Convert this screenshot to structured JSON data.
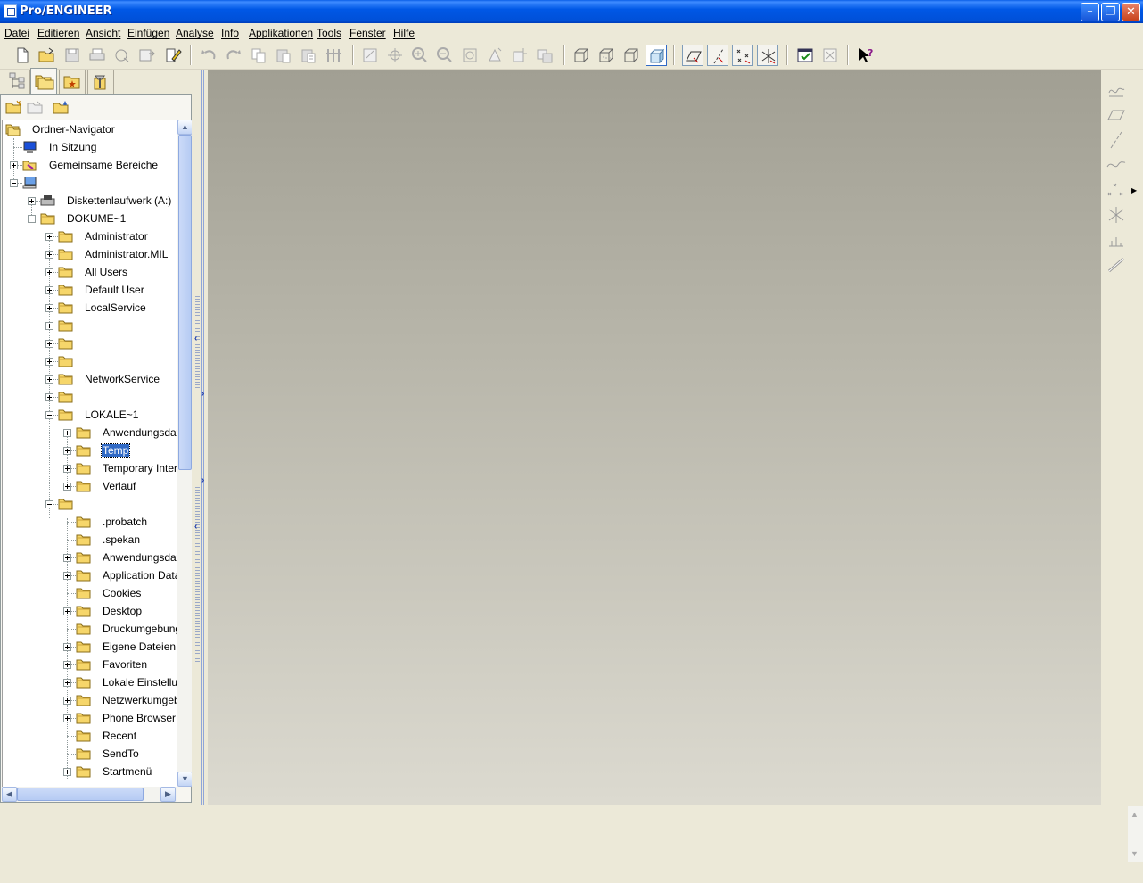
{
  "window": {
    "title": "Pro/ENGINEER",
    "minimize_glyph": "–",
    "maximize_glyph": "❐",
    "close_glyph": "✕"
  },
  "menu": [
    "Datei",
    "Editieren",
    "Ansicht",
    "Einfügen",
    "Analyse",
    "Info",
    "Applikationen",
    "Tools",
    "Fenster",
    "Hilfe"
  ],
  "navigator": {
    "tree": [
      {
        "label": "Ordner-Navigator",
        "icon": "folder-navigator-icon"
      },
      {
        "label": "In Sitzung",
        "icon": "monitor-icon"
      },
      {
        "label": "Gemeinsame Bereiche",
        "icon": "shared-areas-icon"
      },
      {
        "label": "",
        "icon": "computer-icon"
      },
      {
        "label": "Diskettenlaufwerk (A:)",
        "icon": "floppy-icon"
      },
      {
        "label": "DOKUME~1",
        "icon": "folder-icon"
      },
      {
        "label": "Administrator",
        "icon": "folder-icon"
      },
      {
        "label": "Administrator.MIL",
        "icon": "folder-icon"
      },
      {
        "label": "All Users",
        "icon": "folder-icon"
      },
      {
        "label": "Default User",
        "icon": "folder-icon"
      },
      {
        "label": "LocalService",
        "icon": "folder-icon"
      },
      {
        "label": "",
        "icon": "folder-icon"
      },
      {
        "label": "",
        "icon": "folder-icon"
      },
      {
        "label": "",
        "icon": "folder-icon"
      },
      {
        "label": "NetworkService",
        "icon": "folder-icon"
      },
      {
        "label": "",
        "icon": "folder-icon"
      },
      {
        "label": "LOKALE~1",
        "icon": "folder-icon"
      },
      {
        "label": "Anwendungsdate",
        "icon": "folder-icon"
      },
      {
        "label": "Temp",
        "icon": "folder-icon",
        "selected": true
      },
      {
        "label": "Temporary Interne",
        "icon": "folder-icon"
      },
      {
        "label": "Verlauf",
        "icon": "folder-icon"
      },
      {
        "label": "",
        "icon": "folder-icon"
      },
      {
        "label": ".probatch",
        "icon": "folder-icon"
      },
      {
        "label": ".spekan",
        "icon": "folder-icon"
      },
      {
        "label": "Anwendungsdate",
        "icon": "folder-icon"
      },
      {
        "label": "Application Data",
        "icon": "folder-icon"
      },
      {
        "label": "Cookies",
        "icon": "folder-icon"
      },
      {
        "label": "Desktop",
        "icon": "folder-icon"
      },
      {
        "label": "Druckumgebung",
        "icon": "folder-icon"
      },
      {
        "label": "Eigene Dateien",
        "icon": "folder-icon"
      },
      {
        "label": "Favoriten",
        "icon": "folder-icon"
      },
      {
        "label": "Lokale Einstellung",
        "icon": "folder-icon"
      },
      {
        "label": "Netzwerkumgebu",
        "icon": "folder-icon"
      },
      {
        "label": "Phone Browser",
        "icon": "folder-icon"
      },
      {
        "label": "Recent",
        "icon": "folder-icon"
      },
      {
        "label": "SendTo",
        "icon": "folder-icon"
      },
      {
        "label": "Startmenü",
        "icon": "folder-icon"
      }
    ]
  },
  "colors": {
    "selection": "#316ac5",
    "titlebar": "#0058e6",
    "graphics_top": "#a19f93",
    "graphics_bottom": "#dcdad0"
  }
}
